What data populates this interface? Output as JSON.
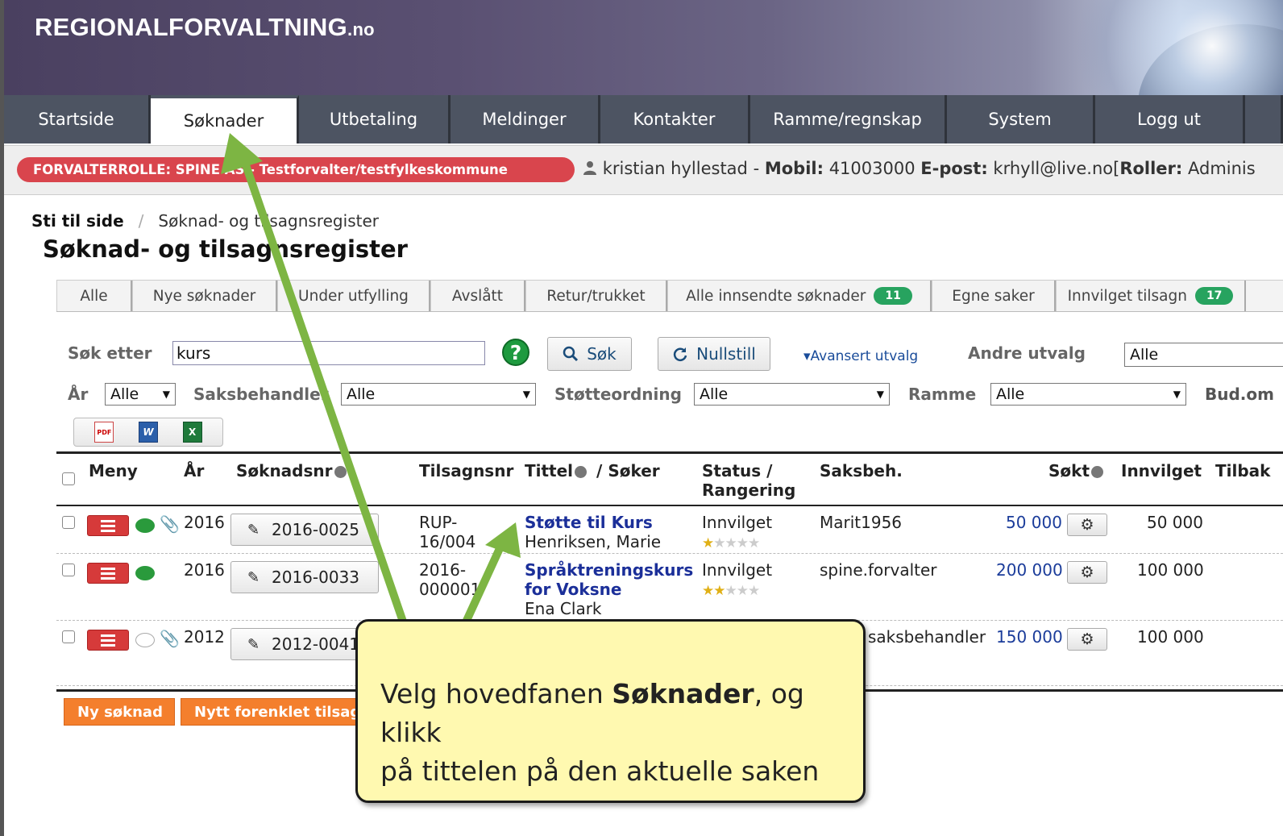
{
  "header": {
    "logo_main": "REGIONALFORVALTNING",
    "logo_tld": ".no"
  },
  "nav": {
    "tabs": [
      {
        "label": "Startside"
      },
      {
        "label": "Søknader",
        "active": true
      },
      {
        "label": "Utbetaling"
      },
      {
        "label": "Meldinger"
      },
      {
        "label": "Kontakter"
      },
      {
        "label": "Ramme/regnskap"
      },
      {
        "label": "System"
      },
      {
        "label": "Logg ut"
      }
    ]
  },
  "rolebar": {
    "role": "FORVALTERROLLE: SPINE AS - Testforvalter/testfylkeskommune",
    "user": "kristian hyllestad",
    "sep": "-",
    "mobile_label": "Mobil:",
    "mobile": "41003000",
    "email_label": "E-post:",
    "email": "krhyll@live.no",
    "roles_open": "[",
    "roles_label": "Roller:",
    "roles": "Adminis"
  },
  "breadcrumb": {
    "root": "Sti til side",
    "sep": "/",
    "current": "Søknad- og tilsagnsregister"
  },
  "page_title": "Søknad- og tilsagnsregister",
  "subtabs": [
    {
      "label": "Alle"
    },
    {
      "label": "Nye søknader"
    },
    {
      "label": "Under utfylling"
    },
    {
      "label": "Avslått"
    },
    {
      "label": "Retur/trukket"
    },
    {
      "label": "Alle innsendte søknader",
      "count": "11"
    },
    {
      "label": "Egne saker"
    },
    {
      "label": "Innvilget tilsagn",
      "count": "17"
    }
  ],
  "search": {
    "label": "Søk etter",
    "value": "kurs",
    "search_button": "Søk",
    "reset_button": "Nullstill",
    "advanced_link": "▾Avansert utvalg",
    "other_label": "Andre utvalg",
    "other_value": "Alle",
    "help_glyph": "?",
    "search_icon": "magnifier-icon",
    "reset_icon": "refresh-icon"
  },
  "filters": {
    "year_label": "År",
    "year_value": "Alle",
    "handler_label": "Saksbehandler",
    "handler_value": "Alle",
    "scheme_label": "Støtteordning",
    "scheme_value": "Alle",
    "frame_label": "Ramme",
    "frame_value": "Alle",
    "budget_label": "Bud.om"
  },
  "export": {
    "pdf": "PDF",
    "word": "W",
    "excel": "X"
  },
  "table": {
    "headers": {
      "menu": "Meny",
      "year": "År",
      "appno": "Søknadsnr",
      "grantno": "Tilsagnsnr",
      "title": "Tittel",
      "title_sep": "/ Søker",
      "status": "Status /",
      "ranking": "Rangering",
      "handler": "Saksbeh.",
      "applied": "Søkt",
      "granted": "Innvilget",
      "repaid": "Tilbak"
    },
    "rows": [
      {
        "year": "2016",
        "appno": "2016-0025",
        "grant_l1": "RUP-",
        "grant_l2": "16/004",
        "title_l1": "Støtte til Kurs",
        "title_l2": "",
        "applicant": "Henriksen, Marie",
        "status": "Innvilget",
        "stars": 1,
        "handler": "Marit1956",
        "applied": "50 000",
        "granted": "50 000",
        "comment": true,
        "attachment": true
      },
      {
        "year": "2016",
        "appno": "2016-0033",
        "grant_l1": "2016-",
        "grant_l2": "000001",
        "title_l1": "Språktreningskurs",
        "title_l2": "for Voksne",
        "applicant": "Ena Clark",
        "status": "Innvilget",
        "stars": 2,
        "handler": "spine.forvalter",
        "applied": "200 000",
        "granted": "100 000",
        "comment": true,
        "attachment": false
      },
      {
        "year": "2012",
        "appno": "2012-0041",
        "grant_l1": "",
        "grant_l2": "",
        "title_l1": "",
        "title_l2": "",
        "applicant": "",
        "status": "",
        "stars": 0,
        "handler": "saksbehandler",
        "applied": "150 000",
        "granted": "100 000",
        "comment": false,
        "attachment": true
      }
    ]
  },
  "actions": {
    "new_application": "Ny søknad",
    "new_simple": "Nytt forenklet tilsagn"
  },
  "callout": {
    "pre": "Velg hovedfanen ",
    "bold": "Søknader",
    "post": ", og klikk",
    "line2": "på tittelen på den aktuelle saken"
  },
  "colors": {
    "accent_red": "#d9454d",
    "nav_bg": "#4d5462",
    "success": "#27a35f",
    "orange": "#f47f2d",
    "arrow": "#7db543",
    "callout_bg": "#fff9b0"
  }
}
